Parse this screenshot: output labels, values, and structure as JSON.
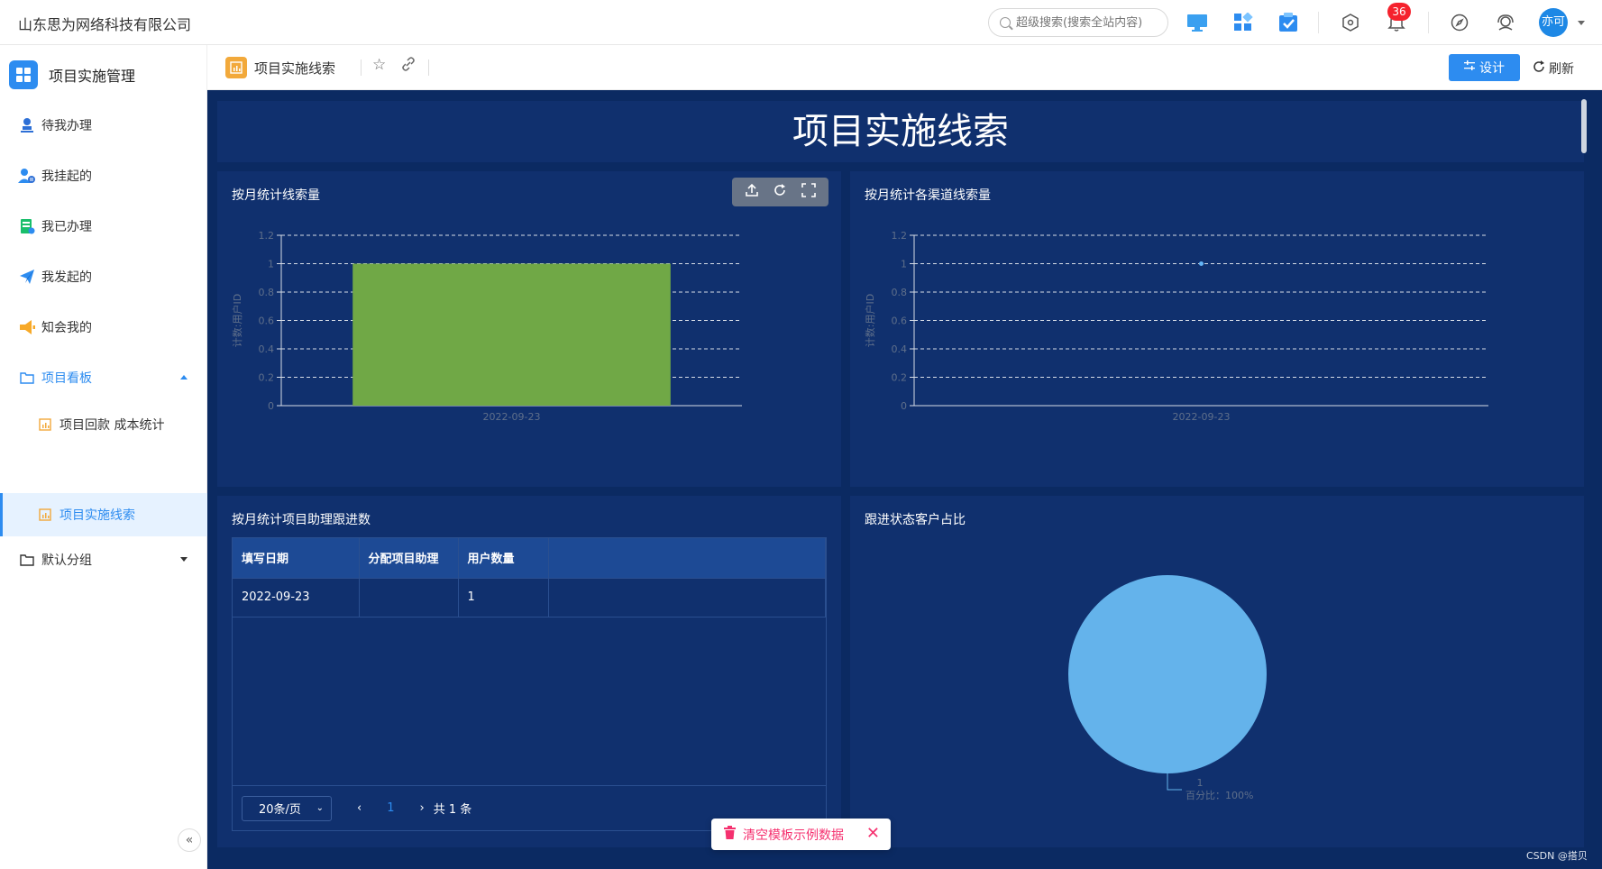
{
  "topbar": {
    "company": "山东思为网络科技有限公司",
    "search_placeholder": "超级搜索(搜索全站内容)",
    "notification_count": "36",
    "avatar_text": "亦可"
  },
  "sidebar": {
    "app_title": "项目实施管理",
    "items": [
      {
        "label": "待我办理",
        "icon": "user-stamp-icon"
      },
      {
        "label": "我挂起的",
        "icon": "user-pause-icon"
      },
      {
        "label": "我已办理",
        "icon": "task-done-icon"
      },
      {
        "label": "我发起的",
        "icon": "send-icon"
      },
      {
        "label": "知会我的",
        "icon": "megaphone-icon"
      },
      {
        "label": "项目看板",
        "icon": "folder-icon"
      },
      {
        "label": "项目回款 成本统计",
        "icon": "chart-icon"
      },
      {
        "label": "项目实施线索",
        "icon": "chart-icon"
      },
      {
        "label": "默认分组",
        "icon": "folder-icon"
      }
    ],
    "collapse_label": "«"
  },
  "pagehead": {
    "title": "项目实施线索",
    "design_label": "设计",
    "refresh_label": "刷新"
  },
  "dashboard": {
    "banner_title": "项目实施线索",
    "panel1_title": "按月统计线索量",
    "panel2_title": "按月统计各渠道线索量",
    "panel3_title": "按月统计项目助理跟进数",
    "panel4_title": "跟进状态客户占比"
  },
  "chart_data": [
    {
      "type": "bar",
      "title": "按月统计线索量",
      "categories": [
        "2022-09-23"
      ],
      "values": [
        1
      ],
      "ylabel": "计数:用户ID",
      "ylim": [
        0,
        1.2
      ],
      "yticks": [
        "0",
        "0.2",
        "0.4",
        "0.6",
        "0.8",
        "1",
        "1.2"
      ],
      "color": "#70a846",
      "grid": true
    },
    {
      "type": "line",
      "title": "按月统计各渠道线索量",
      "categories": [
        "2022-09-23"
      ],
      "values": [
        1
      ],
      "ylabel": "计数:用户ID",
      "ylim": [
        0,
        1.2
      ],
      "yticks": [
        "0",
        "0.2",
        "0.4",
        "0.6",
        "0.8",
        "1",
        "1.2"
      ],
      "color": "#64b5f6",
      "grid": true
    },
    {
      "type": "table",
      "title": "按月统计项目助理跟进数",
      "columns": [
        "填写日期",
        "分配项目助理",
        "用户数量"
      ],
      "rows": [
        [
          "2022-09-23",
          "",
          "1"
        ]
      ]
    },
    {
      "type": "pie",
      "title": "跟进状态客户占比",
      "slices": [
        {
          "label": "1",
          "value": 1,
          "percent_label": "百分比：100%",
          "color": "#64b3eb"
        }
      ]
    }
  ],
  "table": {
    "columns": [
      "填写日期",
      "分配项目助理",
      "用户数量"
    ],
    "row1": {
      "date": "2022-09-23",
      "assistant": "",
      "count": "1"
    }
  },
  "pager": {
    "page_size": "20条/页",
    "current_page": "1",
    "total": "共 1 条"
  },
  "clear_bar": {
    "label": "清空模板示例数据"
  },
  "credit": "CSDN @搭贝"
}
